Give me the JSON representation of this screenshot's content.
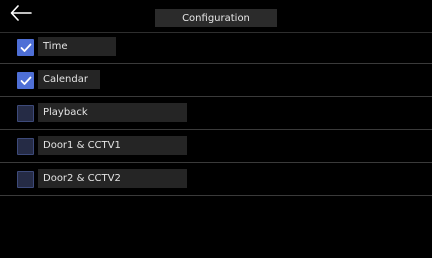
{
  "header": {
    "back_icon": "arrow-left-icon",
    "title": "Configuration"
  },
  "colors": {
    "checked": "#4e6fd6",
    "unchecked": "#252b45",
    "label_bg": "#252525",
    "title_bg": "#2b2b2b"
  },
  "options": [
    {
      "label": "Time",
      "checked": true
    },
    {
      "label": "Calendar",
      "checked": true
    },
    {
      "label": "Playback",
      "checked": false
    },
    {
      "label": "Door1 & CCTV1",
      "checked": false
    },
    {
      "label": "Door2 & CCTV2",
      "checked": false
    }
  ]
}
